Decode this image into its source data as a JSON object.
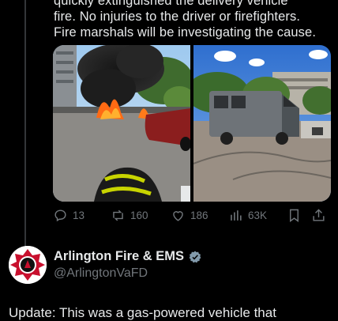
{
  "tweet": {
    "lines": [
      "quickly extinguished the delivery vehicle",
      "fire. No injuries to the driver or firefighters.",
      "Fire marshals will be investigating the cause."
    ]
  },
  "actions": {
    "replies": "13",
    "reposts": "160",
    "likes": "186",
    "views": "63K"
  },
  "next_tweet": {
    "name": "Arlington Fire & EMS",
    "handle": "@ArlingtonVaFD",
    "text": "Update: This was a gas-powered vehicle that"
  },
  "colors": {
    "background": "#000000",
    "text": "#e7e9ea",
    "muted": "#71767b",
    "verified": "#829aab"
  },
  "icons": [
    "reply-icon",
    "repost-icon",
    "like-icon",
    "views-icon",
    "bookmark-icon",
    "share-icon",
    "verified-icon"
  ]
}
